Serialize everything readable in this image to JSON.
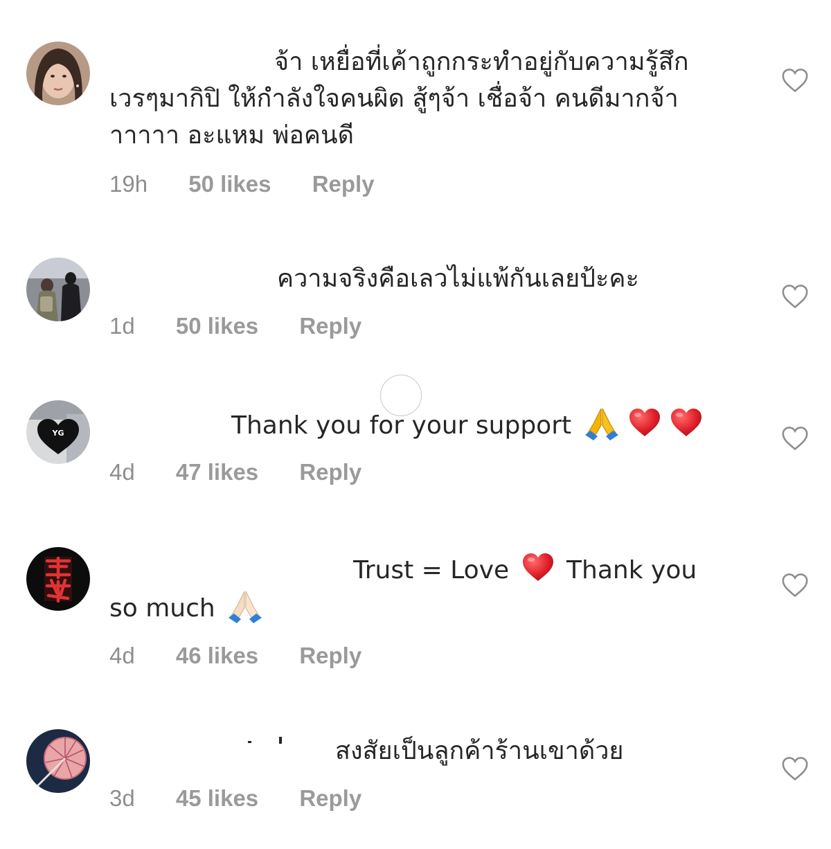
{
  "comments": [
    {
      "avatar_icon": "profile-photo-avatar",
      "lines": [
        "จ้า เหยื่อที่เค้าถูกกระทำอยู่กับความรู้สึก",
        "เวรๆมากิปิ  ให้กำลังใจคนผิด สู้ๆจ้า เชื่อจ้า คนดีมากจ้า",
        "าาาาา อะแหม พ่อคนดี"
      ],
      "time": "19h",
      "likes": "50 likes",
      "reply": "Reply"
    },
    {
      "avatar_icon": "group-photo-avatar",
      "lines": [
        "ความจริงคือเลวไม่แพ้กันเลยป้ะคะ"
      ],
      "time": "1d",
      "likes": "50 likes",
      "reply": "Reply"
    },
    {
      "avatar_icon": "black-heart-logo-avatar",
      "lines": [
        "Thank you for your support"
      ],
      "time": "4d",
      "likes": "47 likes",
      "reply": "Reply"
    },
    {
      "avatar_icon": "red-calligraphy-avatar",
      "lines": [
        "Trust = Love",
        "Thank you",
        "so much"
      ],
      "time": "4d",
      "likes": "46 likes",
      "reply": "Reply"
    },
    {
      "avatar_icon": "flower-photo-avatar",
      "lines": [
        "สงสัยเป็นลูกค้าร้านเขาด้วย"
      ],
      "time": "3d",
      "likes": "45 likes",
      "reply": "Reply"
    }
  ],
  "icons": {
    "like": "heart-outline-icon",
    "emoji_pray": "folded-hands-emoji",
    "emoji_heart": "red-heart-emoji"
  },
  "colors": {
    "text": "#262626",
    "meta": "#8e8e8e",
    "heart_outline": "#8e8e8e",
    "emoji_heart": "#e0202a"
  }
}
